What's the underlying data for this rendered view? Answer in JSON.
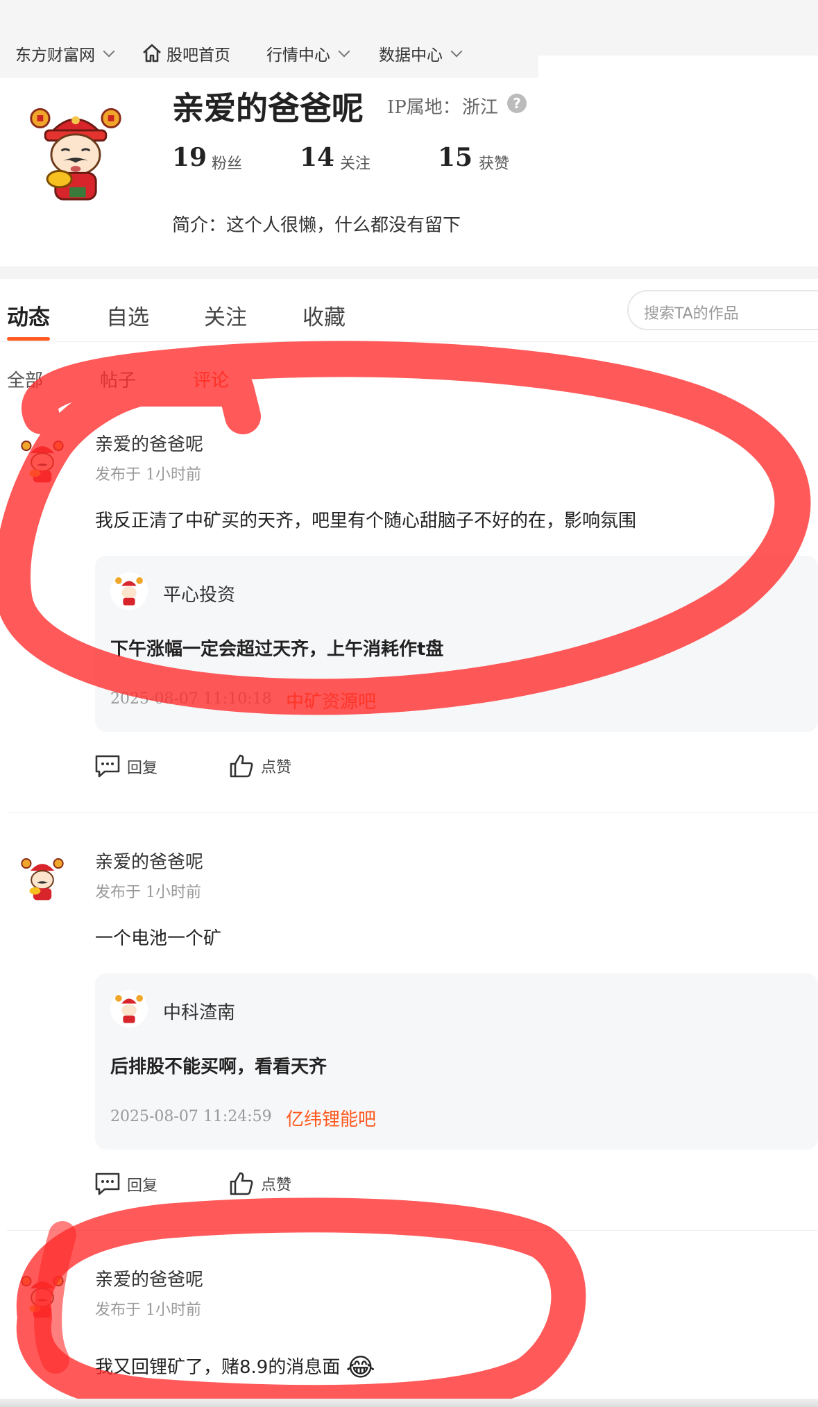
{
  "nav": {
    "site": "东方财富网",
    "home": "股吧首页",
    "market": "行情中心",
    "data": "数据中心"
  },
  "profile": {
    "name": "亲爱的爸爸呢",
    "ip_label": "IP属地：",
    "ip_value": "浙江",
    "help": "?",
    "fans_num": "19",
    "fans_label": "粉丝",
    "follow_num": "14",
    "follow_label": "关注",
    "likes_num": "15",
    "likes_label": "获赞",
    "bio": "简介：这个人很懒，什么都没有留下"
  },
  "tabs": [
    "动态",
    "自选",
    "关注",
    "收藏"
  ],
  "search": {
    "placeholder": "搜索TA的作品"
  },
  "subtabs": [
    "全部",
    "帖子",
    "评论"
  ],
  "feed": [
    {
      "author": "亲爱的爸爸呢",
      "time": "发布于 1小时前",
      "content": "我反正清了中矿买的天齐，吧里有个随心甜脑子不好的在，影响氛围",
      "quote": {
        "name": "平心投资",
        "text": "下午涨幅一定会超过天齐，上午消耗作t盘",
        "time": "2025-08-07 11:10:18",
        "bar": "中矿资源吧"
      },
      "reply": "回复",
      "like": "点赞"
    },
    {
      "author": "亲爱的爸爸呢",
      "time": "发布于 1小时前",
      "content": "一个电池一个矿",
      "quote": {
        "name": "中科渣南",
        "text": "后排股不能买啊，看看天齐",
        "time": "2025-08-07 11:24:59",
        "bar": "亿纬锂能吧"
      },
      "reply": "回复",
      "like": "点赞"
    },
    {
      "author": "亲爱的爸爸呢",
      "time": "发布于 1小时前",
      "content": "我又回锂矿了，赌8.9的消息面",
      "emoji": "😂"
    }
  ],
  "colors": {
    "accent": "#ff5a1f",
    "scribble": "#ff2a2a"
  }
}
